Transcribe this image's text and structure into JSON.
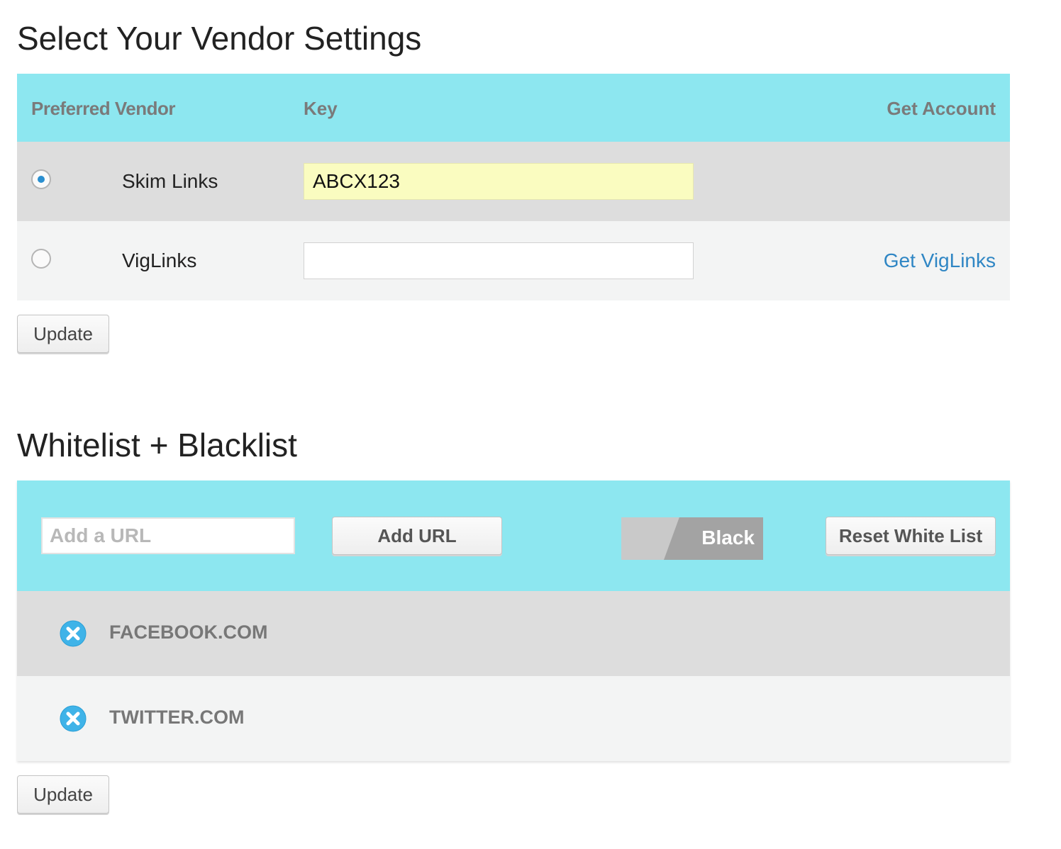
{
  "vendor_section": {
    "title": "Select Your Vendor Settings",
    "headers": {
      "vendor": "Preferred Vendor",
      "key": "Key",
      "account": "Get Account"
    },
    "vendors": [
      {
        "name": "Skim Links",
        "key_value": "ABCX123",
        "selected": true,
        "account_link": ""
      },
      {
        "name": "VigLinks",
        "key_value": "",
        "selected": false,
        "account_link": "Get VigLinks"
      }
    ],
    "update_label": "Update"
  },
  "list_section": {
    "title": "Whitelist + Blacklist",
    "url_input": {
      "placeholder": "Add a URL",
      "value": ""
    },
    "add_url_label": "Add URL",
    "toggle": {
      "label": "Black"
    },
    "reset_label": "Reset White List",
    "entries": [
      {
        "domain": "FACEBOOK.COM",
        "icon": "remove-circle-icon"
      },
      {
        "domain": "TWITTER.COM",
        "icon": "remove-circle-icon"
      }
    ],
    "update_label": "Update"
  },
  "colors": {
    "header_bg": "#8de7f0",
    "row_dark": "#dddddd",
    "row_light": "#f3f4f4",
    "link": "#2f86c4",
    "radio_selected": "#2a8fd0",
    "key_filled_bg": "#fafcc0",
    "remove_icon": "#3fb3e8"
  }
}
